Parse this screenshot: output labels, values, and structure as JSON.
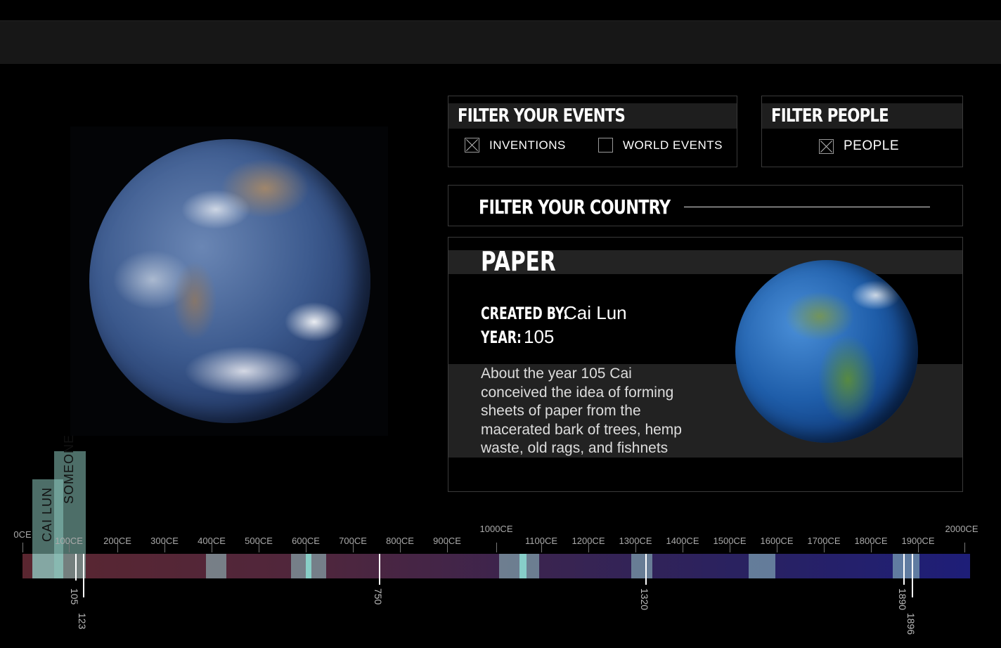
{
  "filters": {
    "events": {
      "title": "FILTER YOUR EVENTS",
      "options": [
        {
          "label": "INVENTIONS",
          "checked": true
        },
        {
          "label": "WORLD EVENTS",
          "checked": false
        }
      ]
    },
    "people": {
      "title": "FILTER PEOPLE",
      "options": [
        {
          "label": "PEOPLE",
          "checked": true
        }
      ]
    },
    "country": {
      "title": "FILTER YOUR COUNTRY",
      "value": ""
    }
  },
  "detail": {
    "title": "PAPER",
    "created_by_label": "CREATED BY:",
    "created_by_value": "Cai Lun",
    "year_label": "YEAR:",
    "year_value": "105",
    "description": "About the year 105 Cai conceived the idea of forming sheets of paper from the macerated bark of trees, hemp waste, old rags, and fishnets"
  },
  "timeline": {
    "scale_labels": [
      "0CE",
      "100CE",
      "200CE",
      "300CE",
      "400CE",
      "500CE",
      "600CE",
      "700CE",
      "800CE",
      "900CE",
      "1000CE",
      "1100CE",
      "1200CE",
      "1300CE",
      "1400CE",
      "1500CE",
      "1600CE",
      "1700CE",
      "1800CE",
      "1900CE",
      "2000CE"
    ],
    "people_tags": [
      {
        "label": "CAI LUN"
      },
      {
        "label": "SOMEONE"
      }
    ],
    "markers": [
      "105",
      "123",
      "750",
      "1320",
      "1890",
      "1896"
    ]
  }
}
